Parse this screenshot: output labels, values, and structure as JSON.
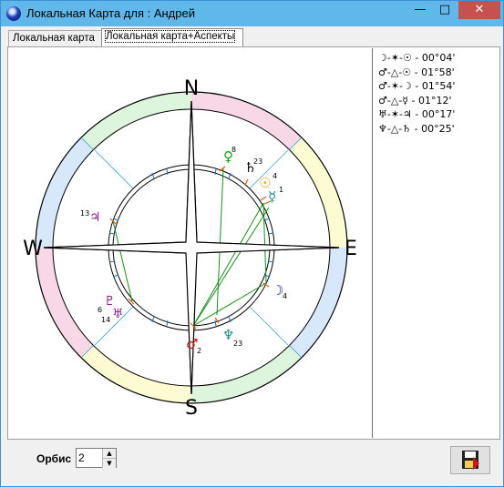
{
  "window": {
    "title": "Локальная Карта для : Андрей",
    "min_glyph": "—",
    "max_glyph": "□",
    "close_glyph": "✕"
  },
  "tabs": [
    {
      "label": "Локальная карта",
      "selected": false
    },
    {
      "label": "Локальная карта+Аспекты",
      "selected": true
    }
  ],
  "compass": {
    "north": "N",
    "south": "S",
    "west": "W",
    "east": "E"
  },
  "planets": [
    {
      "glyph": "♀",
      "degree": "8",
      "color": "#14a014"
    },
    {
      "glyph": "♄",
      "degree": "23",
      "color": "#000000"
    },
    {
      "glyph": "☉",
      "degree": "4",
      "color": "#f0a000"
    },
    {
      "glyph": "☿",
      "degree": "1",
      "color": "#1a8c8c"
    },
    {
      "glyph": "☽",
      "degree": "4",
      "color": "#1a1ab4"
    },
    {
      "glyph": "♆",
      "degree": "23",
      "color": "#1a8c8c"
    },
    {
      "glyph": "♂",
      "degree": "2",
      "color": "#d01010"
    },
    {
      "glyph": "♇",
      "degree": "6",
      "color": "#8c1a8c"
    },
    {
      "glyph": "♅",
      "degree": "14",
      "color": "#8c1a8c"
    },
    {
      "glyph": "♃",
      "degree": "13",
      "color": "#8c1a8c"
    }
  ],
  "aspects": [
    "☽-✶-☉ - 00°04'",
    "♂-△-☉ - 01°58'",
    "♂-✶-☽ - 01°54'",
    "♂-△-☿ - 01°12'",
    "♅-✶-♃ - 00°17'",
    "♆-△-♄ - 00°25'"
  ],
  "orbis": {
    "label": "Орбис",
    "value": "2",
    "up": "▲",
    "down": "▼"
  },
  "save": {
    "icon": "save-icon"
  }
}
